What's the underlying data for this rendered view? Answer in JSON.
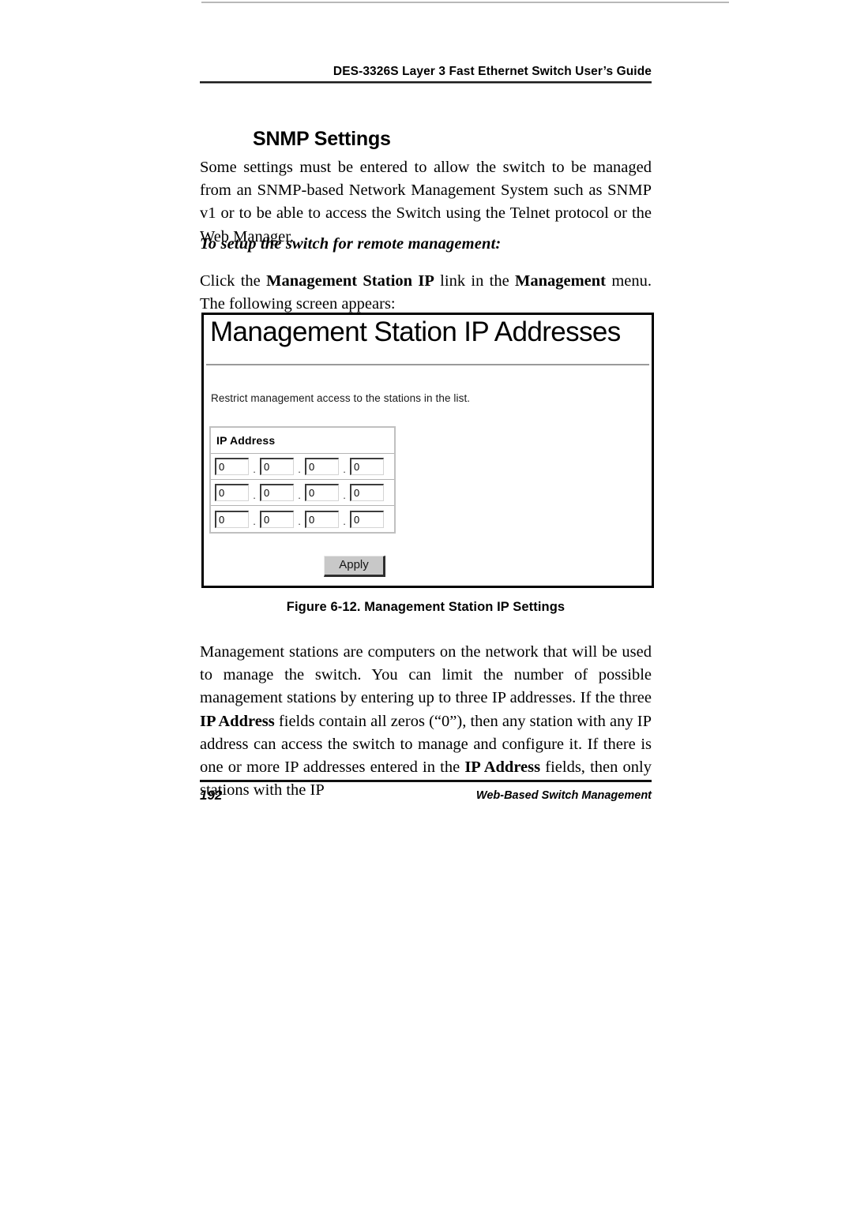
{
  "header": {
    "running_title": "DES-3326S Layer 3 Fast Ethernet Switch User’s Guide"
  },
  "section": {
    "heading": "SNMP Settings",
    "intro_paragraph": "Some settings must be entered to allow the switch to be managed from an SNMP-based Network Management System such as SNMP v1 or to be able to access the Switch using the Telnet protocol or the Web Manager.",
    "subheading": "To setup the switch for remote management:",
    "instruction": {
      "before_link": "Click the ",
      "link_label": "Management Station IP",
      "middle": " link in the ",
      "menu_label": "Management",
      "after": " menu. The following screen appears:"
    }
  },
  "figure": {
    "screen_title": "Management Station IP Addresses",
    "description": "Restrict management access to the stations in the list.",
    "table": {
      "column_header": "IP Address",
      "rows": [
        {
          "octets": [
            "0",
            "0",
            "0",
            "0"
          ]
        },
        {
          "octets": [
            "0",
            "0",
            "0",
            "0"
          ]
        },
        {
          "octets": [
            "0",
            "0",
            "0",
            "0"
          ]
        }
      ],
      "separator": "."
    },
    "apply_label": "Apply",
    "caption": "Figure 6-12.  Management Station IP Settings"
  },
  "closing_paragraph": {
    "t1": "Management stations are computers on the network that will be used to manage the switch. You can limit the number of possible management stations by entering up to three IP addresses. If the three ",
    "b1": "IP Address",
    "t2": " fields contain all zeros (“0”), then any station with any IP address can access the switch to manage and configure it. If there is one or more IP addresses entered in the ",
    "b2": "IP Address",
    "t3": " fields, then only stations with the IP"
  },
  "footer": {
    "page_number": "192",
    "section_label": "Web-Based Switch Management"
  }
}
